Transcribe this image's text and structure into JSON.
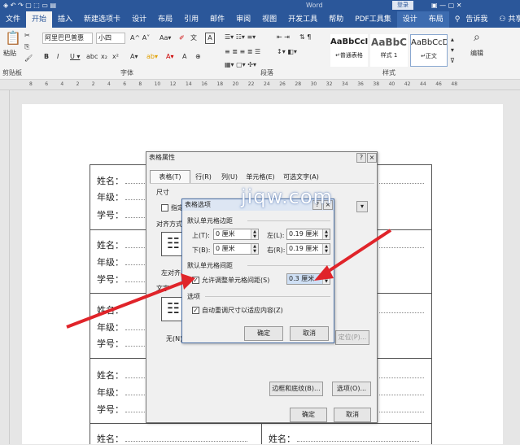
{
  "title": {
    "center": "Word",
    "user": "登录"
  },
  "tabs": [
    "文件",
    "开始",
    "插入",
    "新建选项卡",
    "设计",
    "布局",
    "引用",
    "邮件",
    "审阅",
    "视图",
    "开发工具",
    "帮助",
    "PDF工具集",
    "设计",
    "布局"
  ],
  "tell_me": "告诉我",
  "share": "共享",
  "ribbon": {
    "paste": "粘贴",
    "clipboard": "剪贴板",
    "font_group": "字体",
    "para_group": "段落",
    "styles_group": "样式",
    "edit": "编辑",
    "font_name": "阿里巴巴普惠",
    "font_size": "小四",
    "style1": {
      "sample": "AaBbCcI",
      "name": "↵普通表格"
    },
    "style2": {
      "sample": "AaBbC",
      "name": "样式 1"
    },
    "style3": {
      "sample": "AaBbCcD",
      "name": "↵正文"
    }
  },
  "ruler_numbers": [
    "8",
    "6",
    "4",
    "2",
    "2",
    "4",
    "6",
    "8",
    "10",
    "12",
    "14",
    "16",
    "18",
    "20",
    "22",
    "24",
    "26",
    "28",
    "30",
    "32",
    "34",
    "36",
    "38",
    "40",
    "42",
    "44",
    "46",
    "48"
  ],
  "doc": {
    "name": "姓名：",
    "grade": "年级：",
    "id": "学号："
  },
  "watermark": "jiqw.com",
  "table_props": {
    "title": "表格属性",
    "help": "?",
    "close": "×",
    "tabs": [
      "表格(T)",
      "行(R)",
      "列(U)",
      "单元格(E)",
      "可选文字(A)"
    ],
    "size": "尺寸",
    "specify": "指定",
    "align": "对齐方式",
    "left_align": "左对齐",
    "wrap": "文字",
    "none": "无(N)",
    "pos_btn": "定位(P)...",
    "borders": "边框和底纹(B)...",
    "options": "选项(O)...",
    "ok": "确定",
    "cancel": "取消"
  },
  "table_opts": {
    "title": "表格选项",
    "help": "?",
    "close": "×",
    "margins": "默认单元格边距",
    "top_lbl": "上(T):",
    "top_val": "0 厘米",
    "left_lbl": "左(L):",
    "left_val": "0.19 厘米",
    "bottom_lbl": "下(B):",
    "bottom_val": "0 厘米",
    "right_lbl": "右(R):",
    "right_val": "0.19 厘米",
    "spacing": "默认单元格间距",
    "allow": "允许调整单元格间距(S)",
    "spacing_val": "0.3 厘米",
    "options": "选项",
    "autofit": "自动重调尺寸以适应内容(Z)",
    "ok": "确定",
    "cancel": "取消"
  },
  "colors": {
    "brand": "#2b579a",
    "arrow": "#e0242a"
  }
}
